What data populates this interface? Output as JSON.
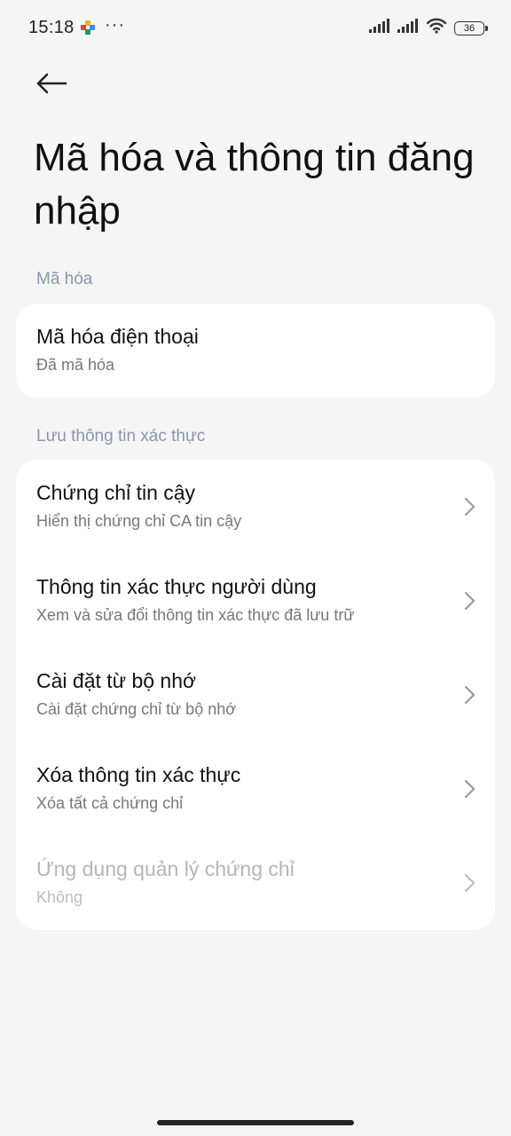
{
  "status_bar": {
    "time": "15:18",
    "more": "···",
    "battery": "36",
    "icons": [
      "app-notification-icon",
      "signal-icon",
      "signal-icon",
      "wifi-icon",
      "battery-icon"
    ]
  },
  "header": {
    "back_icon": "arrow-left-icon",
    "title": "Mã hóa và thông tin đăng nhập"
  },
  "sections": [
    {
      "header": "Mã hóa",
      "items": [
        {
          "title": "Mã hóa điện thoại",
          "subtitle": "Đã mã hóa"
        }
      ]
    },
    {
      "header": "Lưu thông tin xác thực",
      "items": [
        {
          "title": "Chứng chỉ tin cậy",
          "subtitle": "Hiển thị chứng chỉ CA tin cậy"
        },
        {
          "title": "Thông tin xác thực người dùng",
          "subtitle": "Xem và sửa đổi thông tin xác thực đã lưu trữ"
        },
        {
          "title": "Cài đặt từ bộ nhớ",
          "subtitle": "Cài đặt chứng chỉ từ bộ nhớ"
        },
        {
          "title": "Xóa thông tin xác thực",
          "subtitle": "Xóa tất cả chứng chỉ"
        },
        {
          "title": "Ứng dụng quản lý chứng chỉ",
          "subtitle": "Không",
          "disabled": true
        }
      ]
    }
  ],
  "colors": {
    "background": "#f5f5f5",
    "card": "#ffffff",
    "section_header": "#8a96ad",
    "disabled_text": "#b5b5b5"
  }
}
